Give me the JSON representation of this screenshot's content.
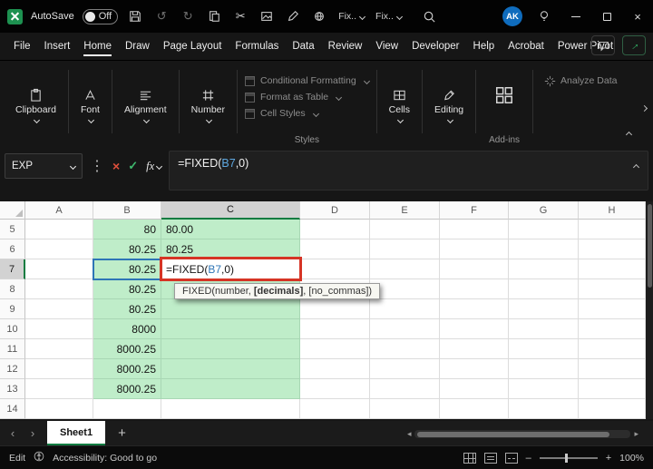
{
  "titlebar": {
    "autosave_label": "AutoSave",
    "autosave_state": "Off",
    "quick_access_fix": [
      "Fix..",
      "Fix.."
    ],
    "avatar_initials": "AK"
  },
  "menubar": {
    "items": [
      "File",
      "Insert",
      "Home",
      "Draw",
      "Page Layout",
      "Formulas",
      "Data",
      "Review",
      "View",
      "Developer",
      "Help",
      "Acrobat",
      "Power Pivot"
    ],
    "active_item": "Home"
  },
  "ribbon": {
    "groups": [
      {
        "label": "Clipboard"
      },
      {
        "label": "Font"
      },
      {
        "label": "Alignment"
      },
      {
        "label": "Number"
      }
    ],
    "styles_items": [
      "Conditional Formatting",
      "Format as Table",
      "Cell Styles"
    ],
    "styles_label": "Styles",
    "cells_label": "Cells",
    "editing_label": "Editing",
    "addins_label": "Add-ins",
    "analyze_label": "Analyze Data"
  },
  "formula_bar": {
    "name_box_value": "EXP",
    "fx_label": "fx",
    "formula": {
      "pre": "=FIXED(",
      "ref": "B7",
      "post": ",0)"
    }
  },
  "grid": {
    "columns": [
      "A",
      "B",
      "C",
      "D",
      "E",
      "F",
      "G",
      "H"
    ],
    "selected_column": "C",
    "selected_row": "7",
    "rows": [
      {
        "num": "5",
        "b": "80",
        "c": "80.00"
      },
      {
        "num": "6",
        "b": "80.25",
        "c": "80.25"
      },
      {
        "num": "7",
        "b": "80.25",
        "c": "FORMULA"
      },
      {
        "num": "8",
        "b": "80.25",
        "c": ""
      },
      {
        "num": "9",
        "b": "80.25",
        "c": ""
      },
      {
        "num": "10",
        "b": "8000",
        "c": ""
      },
      {
        "num": "11",
        "b": "8000.25",
        "c": ""
      },
      {
        "num": "12",
        "b": "8000.25",
        "c": ""
      },
      {
        "num": "13",
        "b": "8000.25",
        "c": ""
      },
      {
        "num": "14",
        "b": null,
        "c": null
      }
    ],
    "tooltip": {
      "pre": "FIXED(number, ",
      "bold": "[decimals]",
      "post": ", [no_commas])"
    }
  },
  "sheet_tabs": {
    "active_tab": "Sheet1",
    "add_label": "+"
  },
  "status_bar": {
    "mode": "Edit",
    "accessibility_text": "Accessibility: Good to go",
    "zoom": "100%"
  },
  "icons": {
    "undo": "↺",
    "redo": "↻",
    "cut": "✂",
    "overflow_dots": "⋮",
    "cancel": "×",
    "check": "✓",
    "close": "×",
    "nav_left": "‹",
    "nav_right": "›",
    "scroll_left": "◂",
    "scroll_right": "▸",
    "zoom_minus": "–",
    "zoom_plus": "+",
    "share_arrow": "→"
  },
  "colors": {
    "excel_green": "#107C41",
    "cell_fill_green": "#BFEDC9",
    "reference_blue": "#2E75B6",
    "annotation_red": "#D63425",
    "avatar_blue": "#0F6CBD"
  }
}
